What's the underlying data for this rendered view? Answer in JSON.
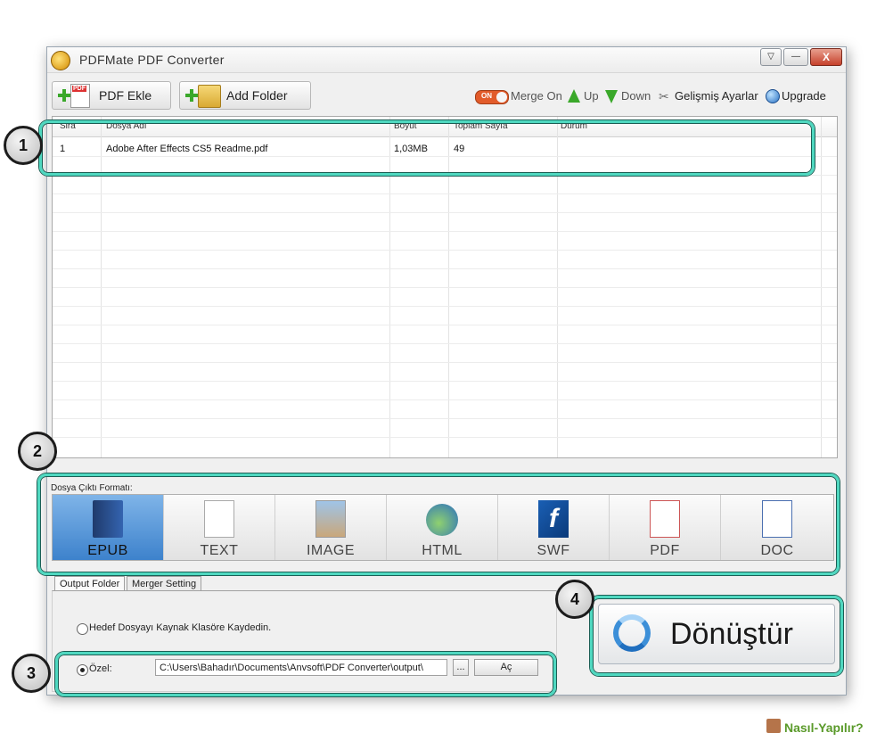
{
  "window": {
    "title": "PDFMate PDF Converter",
    "min_label": "▽",
    "restore_label": "—",
    "close_label": "X"
  },
  "toolbar": {
    "pdf_add_label": "PDF Ekle",
    "add_folder_label": "Add Folder",
    "toggle_text": "ON",
    "merge_label": "Merge On",
    "up_label": "Up",
    "down_label": "Down",
    "advanced_label": "Gelişmiş Ayarlar",
    "upgrade_label": "Upgrade"
  },
  "file_list": {
    "columns": [
      "Sira",
      "Dosya Adı",
      "Boyut",
      "Toplam Sayfa",
      "Durum"
    ],
    "rows": [
      {
        "index": "1",
        "name": "Adobe After Effects CS5 Readme.pdf",
        "size": "1,03MB",
        "pages": "49",
        "status": ""
      }
    ]
  },
  "formats": {
    "label": "Dosya Çıktı Formatı:",
    "items": [
      "EPUB",
      "TEXT",
      "IMAGE",
      "HTML",
      "SWF",
      "PDF",
      "DOC"
    ],
    "selected": "EPUB"
  },
  "output": {
    "tabs": [
      "Output Folder",
      "Merger Setting"
    ],
    "source_option_label": "Hedef Dosyayı Kaynak Klasöre Kaydedin.",
    "custom_option_label": "Özel:",
    "path": "C:\\Users\\Bahadır\\Documents\\Anvsoft\\PDF Converter\\output\\",
    "browse_label": "...",
    "open_label": "Aç"
  },
  "convert": {
    "label": "Dönüştür"
  },
  "callouts": [
    "1",
    "2",
    "3",
    "4"
  ],
  "watermark": "Nasıl-Yapılır?",
  "colors": {
    "callout": "#4fd8c0",
    "selected_format": "#3d82cc",
    "toggle": "#e25b2a"
  }
}
